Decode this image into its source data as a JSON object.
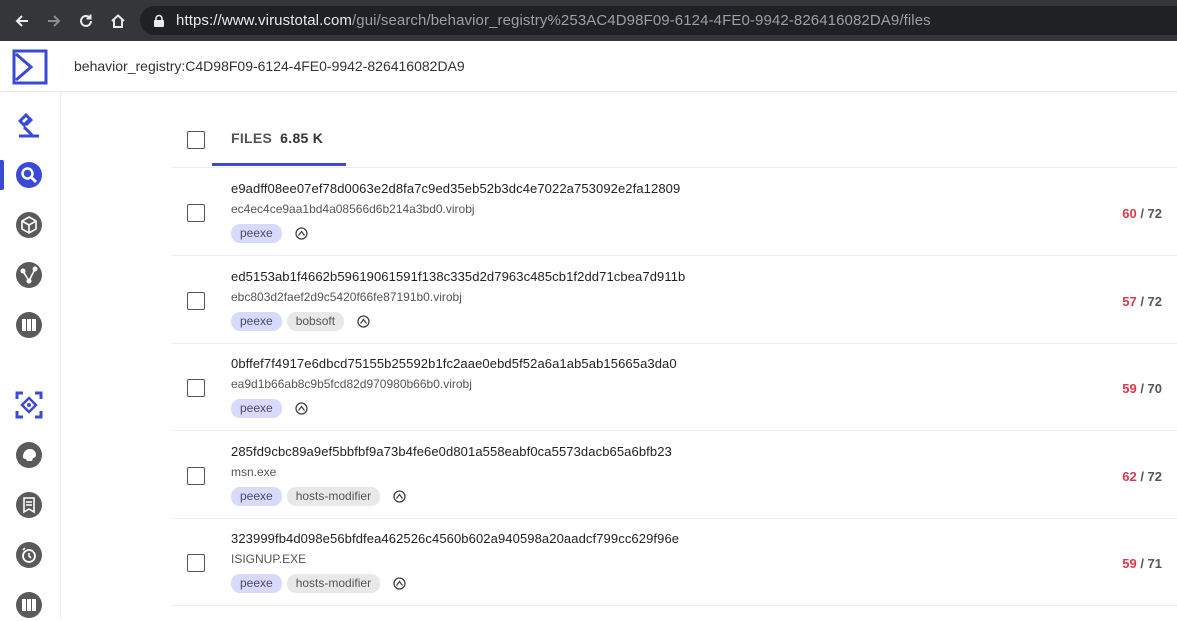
{
  "browser": {
    "url_host": "https://www.virustotal.com",
    "url_path": "/gui/search/behavior_registry%253AC4D98F09-6124-4FE0-9942-826416082DA9/files"
  },
  "header": {
    "query": "behavior_registry:C4D98F09-6124-4FE0-9942-826416082DA9"
  },
  "sidebar": {
    "items": [
      {
        "icon": "intelligence-icon"
      },
      {
        "icon": "search-icon",
        "active": true
      },
      {
        "icon": "graph-cube-icon"
      },
      {
        "icon": "graph-nodes-icon"
      },
      {
        "icon": "collections-icon"
      },
      {
        "icon": "hunting-icon"
      },
      {
        "icon": "threat-actor-icon"
      },
      {
        "icon": "reports-icon"
      },
      {
        "icon": "retrohunt-icon"
      },
      {
        "icon": "library-icon"
      }
    ]
  },
  "tabs": {
    "files_label": "FILES",
    "files_count": "6.85 K"
  },
  "rows": [
    {
      "hash": "e9adff08ee07ef78d0063e2d8fa7c9ed35eb52b3dc4e7022a753092e2fa12809",
      "name": "ec4ec4ce9aa1bd4a08566d6b214a3bd0.virobj",
      "tags": [
        "peexe"
      ],
      "positives": "60",
      "total": "/ 72"
    },
    {
      "hash": "ed5153ab1f4662b59619061591f138c335d2d7963c485cb1f2dd71cbea7d911b",
      "name": "ebc803d2faef2d9c5420f66fe87191b0.virobj",
      "tags": [
        "peexe",
        "bobsoft"
      ],
      "positives": "57",
      "total": "/ 72"
    },
    {
      "hash": "0bffef7f4917e6dbcd75155b25592b1fc2aae0ebd5f52a6a1ab5ab15665a3da0",
      "name": "ea9d1b66ab8c9b5fcd82d970980b66b0.virobj",
      "tags": [
        "peexe"
      ],
      "positives": "59",
      "total": "/ 70"
    },
    {
      "hash": "285fd9cbc89a9ef5bbfbf9a73b4fe6e0d801a558eabf0ca5573dacb65a6bfb23",
      "name": "msn.exe",
      "tags": [
        "peexe",
        "hosts-modifier"
      ],
      "positives": "62",
      "total": "/ 72"
    },
    {
      "hash": "323999fb4d098e56bfdfea462526c4560b602a940598a20aadcf799cc629f96e",
      "name": "ISIGNUP.EXE",
      "tags": [
        "peexe",
        "hosts-modifier"
      ],
      "positives": "59",
      "total": "/ 71"
    }
  ],
  "colors": {
    "accent": "#3a4ad7",
    "positives": "#e0364b",
    "tag_peexe": "#d7dafa",
    "tag_plain": "#e8e8e8"
  }
}
